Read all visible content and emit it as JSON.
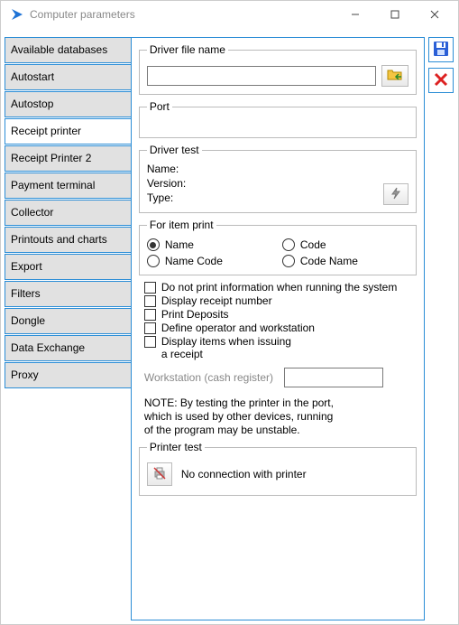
{
  "window": {
    "title": "Computer parameters"
  },
  "sidebar": {
    "items": [
      {
        "label": "Available databases"
      },
      {
        "label": "Autostart"
      },
      {
        "label": "Autostop"
      },
      {
        "label": "Receipt printer"
      },
      {
        "label": "Receipt Printer 2"
      },
      {
        "label": "Payment terminal"
      },
      {
        "label": "Collector"
      },
      {
        "label": "Printouts and charts"
      },
      {
        "label": "Export"
      },
      {
        "label": "Filters"
      },
      {
        "label": "Dongle"
      },
      {
        "label": "Data Exchange"
      },
      {
        "label": "Proxy"
      }
    ],
    "active_index": 3
  },
  "panel": {
    "driver_file": {
      "legend": "Driver file name",
      "value": ""
    },
    "port": {
      "legend": "Port",
      "value": ""
    },
    "driver_test": {
      "legend": "Driver test",
      "name_label": "Name:",
      "name_value": "",
      "version_label": "Version:",
      "version_value": "",
      "type_label": "Type:",
      "type_value": ""
    },
    "item_print": {
      "legend": "For item print",
      "options": [
        "Name",
        "Code",
        "Name Code",
        "Code Name"
      ],
      "selected_index": 0
    },
    "checks": [
      "Do not print information when running the system",
      "Display receipt number",
      "Print Deposits",
      "Define operator and workstation",
      "Display items when issuing a receipt"
    ],
    "workstation": {
      "label": "Workstation (cash register)",
      "value": ""
    },
    "note_line1": "NOTE: By testing the printer in the port,",
    "note_line2": "which is used by other devices, running",
    "note_line3": "of the program may be unstable.",
    "printer_test": {
      "legend": "Printer test",
      "status": "No connection with printer"
    }
  }
}
